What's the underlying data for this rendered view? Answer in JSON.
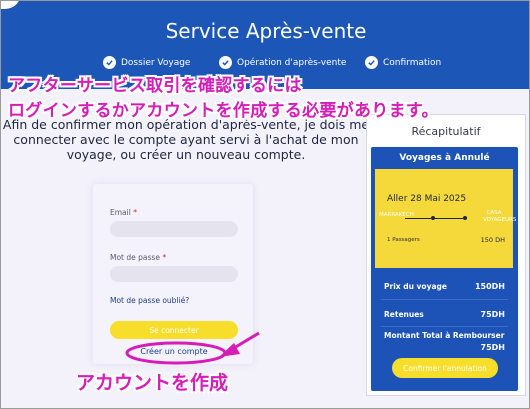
{
  "header": {
    "title": "Service Après-vente",
    "steps": [
      {
        "label": "Dossier Voyage",
        "icon": "check-icon"
      },
      {
        "label": "Opération d'après-vente",
        "icon": "check-icon"
      },
      {
        "label": "Confirmation",
        "icon": "check-icon"
      }
    ]
  },
  "main": {
    "intro": "Afin de confirmer mon opération d'après-vente, je dois me connecter avec le compte ayant servi à l'achat de mon voyage, ou créer un nouveau compte."
  },
  "login": {
    "email_label": "Email",
    "password_label": "Mot de passe",
    "required_mark": "*",
    "forgot_label": "Mot de passe oublié?",
    "connect_label": "Se connecter",
    "create_label": "Créer un compte"
  },
  "recap": {
    "title": "Récapitulatif",
    "card_title": "Voyages à Annulé",
    "trip": {
      "date": "Aller 28 Mai 2025",
      "from": "MARRAKECH",
      "to": "CASA VOYAGEURS",
      "passengers": "1 Passagers",
      "price": "150 DH"
    },
    "rows": [
      {
        "label": "Prix du voyage",
        "value": "150DH"
      },
      {
        "label": "Retenues",
        "value": "75DH"
      }
    ],
    "total_label": "Montant Total à Rembourser",
    "total_value": "75DH",
    "confirm_label": "Confirmer l'annulation"
  },
  "annotations": {
    "line1": "アフターサービス取引を確認するには",
    "line2": "ログインするかアカウントを作成する必要があります。",
    "create": "アカウントを作成",
    "color": "#d61db8"
  },
  "colors": {
    "brand_blue": "#1c57b8",
    "accent_yellow": "#f6de2b",
    "background": "#f3f1f9"
  }
}
